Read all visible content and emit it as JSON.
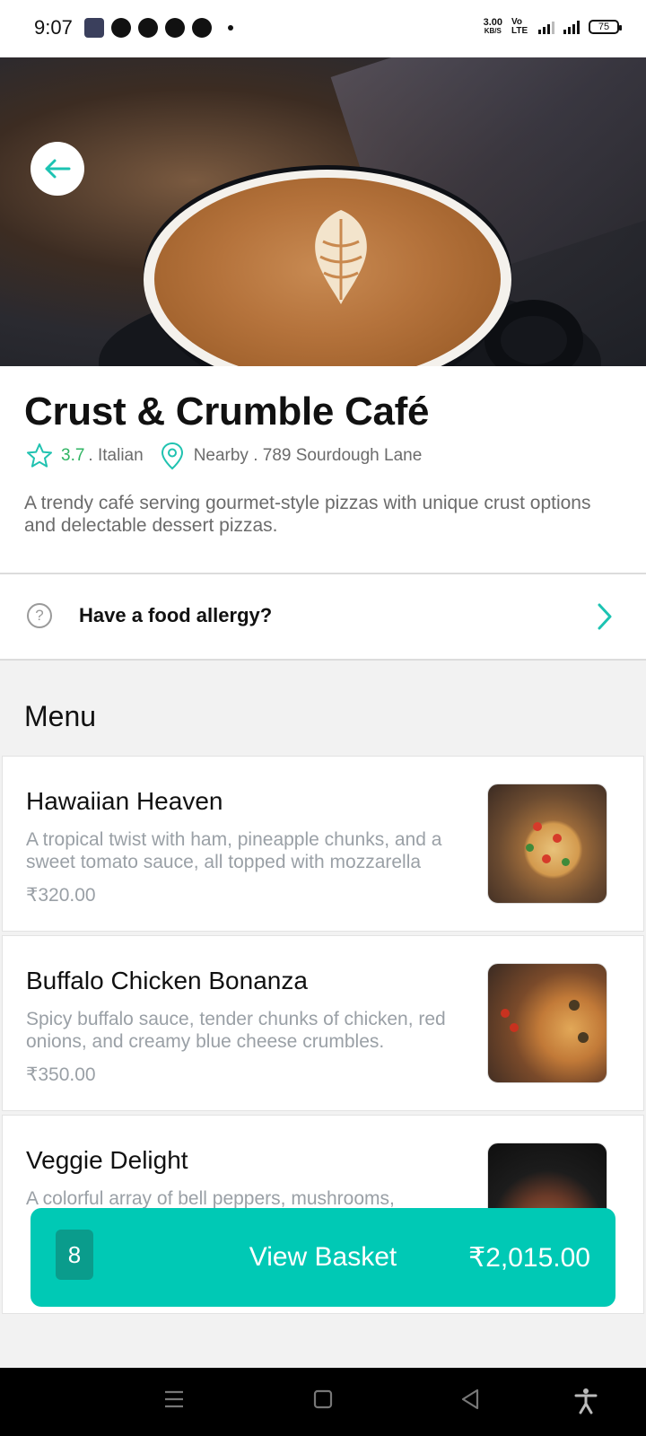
{
  "status_bar": {
    "time": "9:07",
    "net_speed_value": "3.00",
    "net_speed_unit": "KB/S",
    "volte": "Vo LTE",
    "network": "4G",
    "battery": "75"
  },
  "restaurant": {
    "name": "Crust & Crumble Café",
    "rating": "3.7",
    "cuisine": ". Italian",
    "location": "Nearby . 789 Sourdough Lane",
    "description": " A trendy café serving gourmet-style pizzas with unique crust options and delectable dessert pizzas."
  },
  "allergy": {
    "label": "Have a food allergy?",
    "icon": "question-circle-icon"
  },
  "menu": {
    "title": "Menu",
    "items": [
      {
        "name": "Hawaiian Heaven",
        "description": "A tropical twist with ham, pineapple chunks, and a sweet tomato sauce, all topped with mozzarella",
        "price": "₹320.00"
      },
      {
        "name": "Buffalo Chicken Bonanza",
        "description": "Spicy buffalo sauce, tender chunks of chicken, red onions, and creamy blue cheese crumbles.",
        "price": "₹350.00"
      },
      {
        "name": "Veggie Delight",
        "description": "A colorful array of bell peppers, mushrooms,",
        "price": ""
      }
    ]
  },
  "basket": {
    "count": "8",
    "label": "View Basket",
    "total": "₹2,015.00"
  },
  "colors": {
    "accent": "#00c9b5",
    "accent_dark": "#0a9c8c",
    "rating_green": "#2fb463"
  },
  "nav_bar": {
    "icons": [
      "menu-icon",
      "home-icon",
      "back-icon",
      "accessibility-icon"
    ]
  }
}
